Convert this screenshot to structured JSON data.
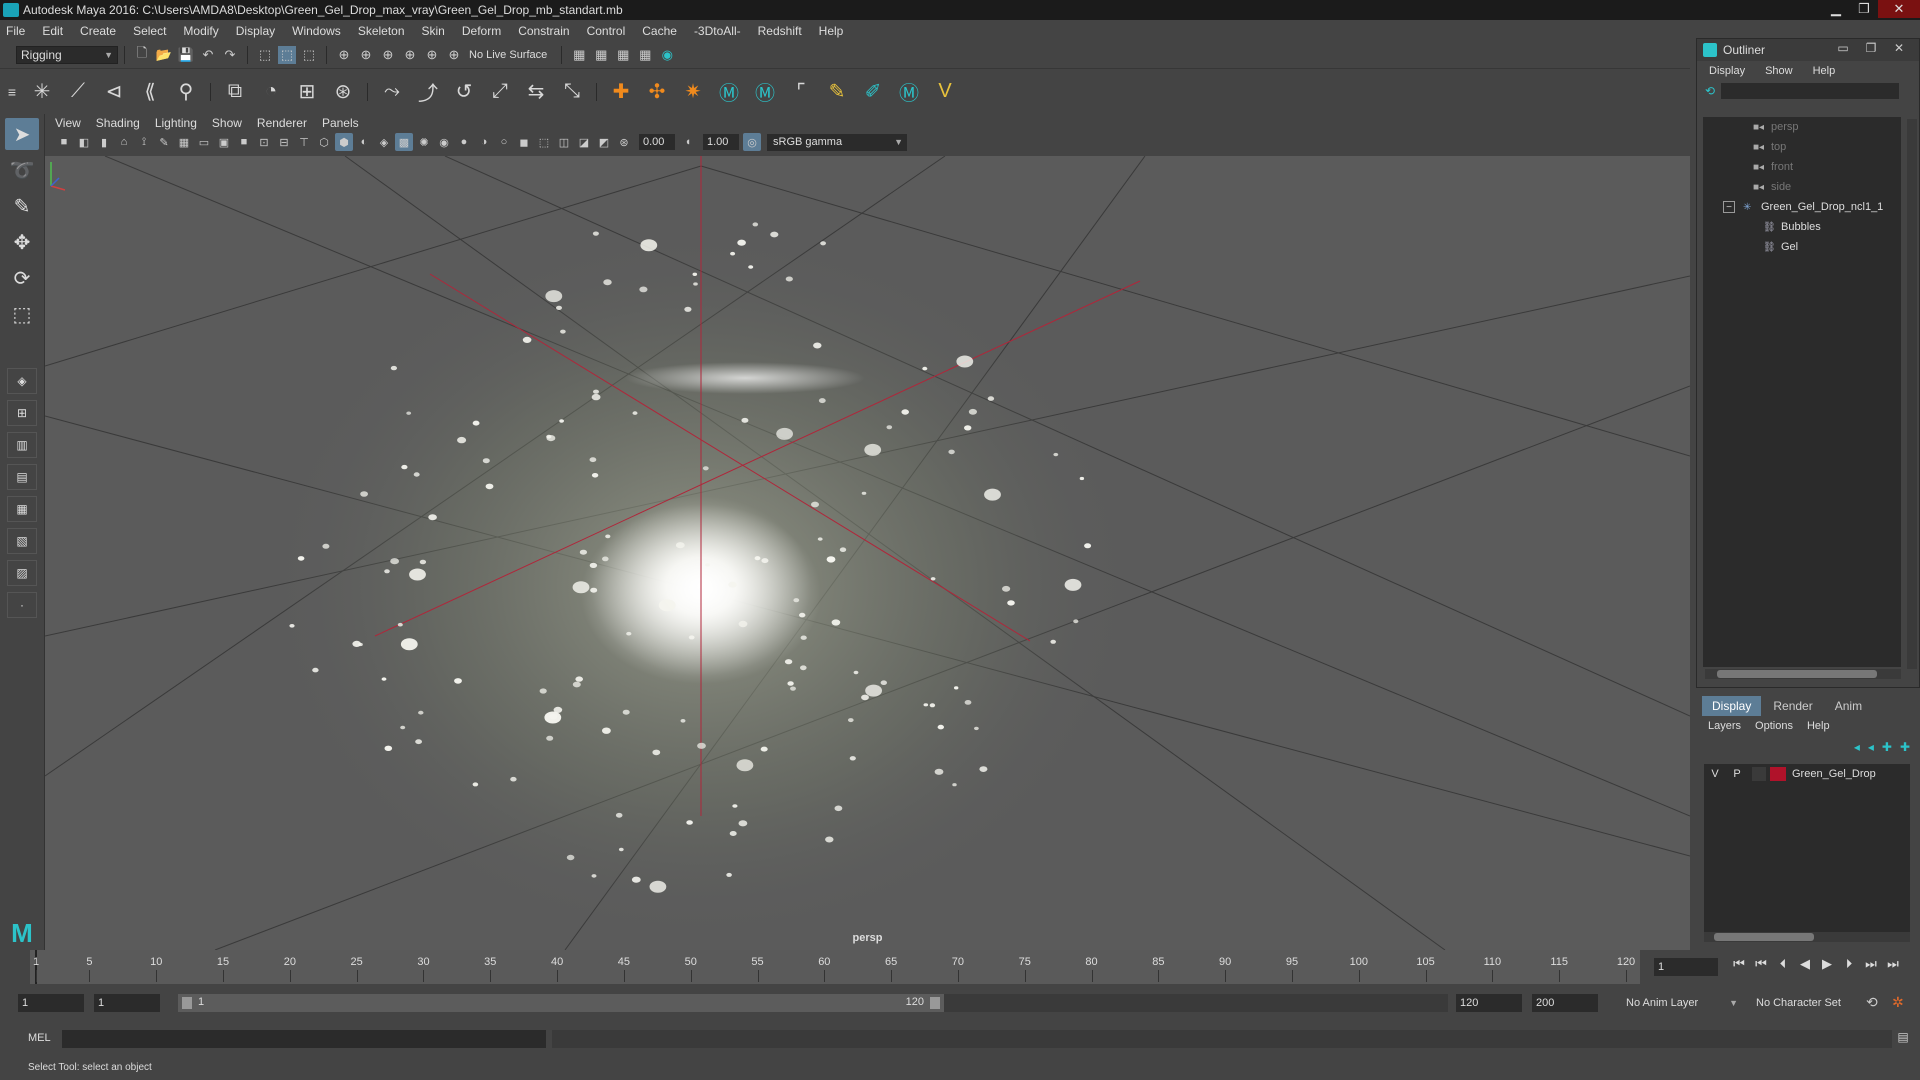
{
  "window": {
    "title": "Autodesk Maya 2016: C:\\Users\\AMDA8\\Desktop\\Green_Gel_Drop_max_vray\\Green_Gel_Drop_mb_standart.mb",
    "controls": [
      "▁",
      "❐",
      "✕"
    ]
  },
  "menubar": {
    "items": [
      "File",
      "Edit",
      "Create",
      "Select",
      "Modify",
      "Display",
      "Windows",
      "Skeleton",
      "Skin",
      "Deform",
      "Constrain",
      "Control",
      "Cache",
      "-3DtoAll-",
      "Redshift",
      "Help"
    ]
  },
  "statusline": {
    "menuset": "Rigging",
    "live_surface": "No Live Surface"
  },
  "viewport": {
    "menu": [
      "View",
      "Shading",
      "Lighting",
      "Show",
      "Renderer",
      "Panels"
    ],
    "exposure": "0.00",
    "gamma": "1.00",
    "color_space": "sRGB gamma",
    "camera_label": "persp",
    "colors": {
      "background": "#5b5b5b",
      "grid": "#3a3a3a",
      "axis": "#b0263a"
    }
  },
  "outliner": {
    "title": "Outliner",
    "controls": [
      "▭",
      "❐",
      "✕"
    ],
    "menu": [
      "Display",
      "Show",
      "Help"
    ],
    "cameras": [
      "persp",
      "top",
      "front",
      "side"
    ],
    "group": {
      "name": "Green_Gel_Drop_ncl1_1",
      "children": [
        "Bubbles",
        "Gel"
      ]
    }
  },
  "layer_editor": {
    "tabs": [
      "Display",
      "Render",
      "Anim"
    ],
    "active_tab": "Display",
    "menu": [
      "Layers",
      "Options",
      "Help"
    ],
    "layers": [
      {
        "visible": "V",
        "playback": "P",
        "name": "Green_Gel_Drop",
        "color": "#b0122a"
      }
    ]
  },
  "timeslider": {
    "ticks": [
      "1",
      "5",
      "10",
      "15",
      "20",
      "25",
      "30",
      "35",
      "40",
      "45",
      "50",
      "55",
      "60",
      "65",
      "70",
      "75",
      "80",
      "85",
      "90",
      "95",
      "100",
      "105",
      "110",
      "115",
      "120"
    ],
    "current_frame": "1",
    "current_frame_value": 1,
    "max_frame": 120
  },
  "rangeslider": {
    "start": "1",
    "playback_start": "1",
    "range_start_label": "1",
    "range_end_label": "120",
    "playback_end": "120",
    "end": "200",
    "anim_layer": "No Anim Layer",
    "character_set": "No Character Set"
  },
  "cmdline": {
    "label": "MEL"
  },
  "helpline": {
    "text": "Select Tool: select an object"
  }
}
